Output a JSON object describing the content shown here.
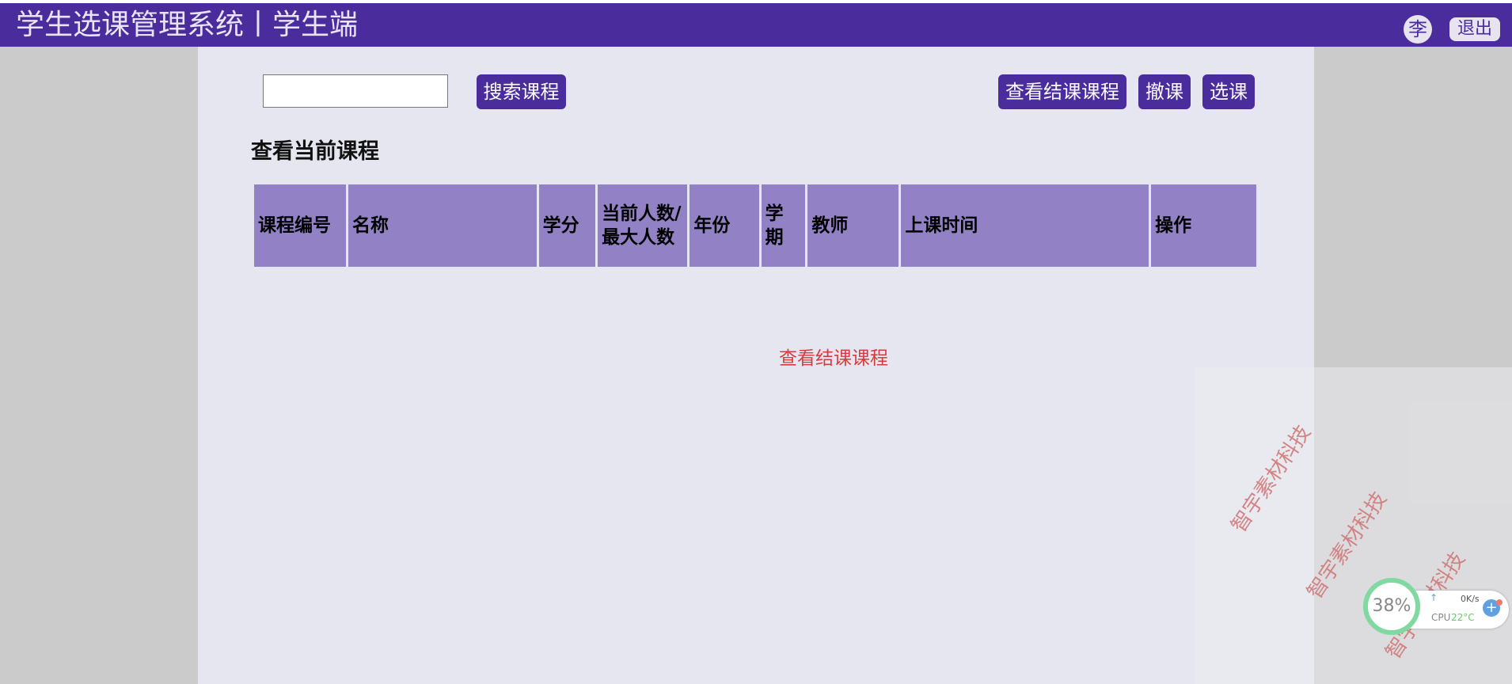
{
  "header": {
    "title": "学生选课管理系统丨学生端",
    "avatar_text": "李",
    "logout_label": "退出"
  },
  "toolbar": {
    "search_value": "",
    "search_label": "搜索课程",
    "view_finished_label": "查看结课课程",
    "drop_label": "撤课",
    "select_label": "选课"
  },
  "section": {
    "title": "查看当前课程"
  },
  "table": {
    "headers": [
      "课程编号",
      "名称",
      "学分",
      "当前人数/最大人数",
      "年份",
      "学期",
      "教师",
      "上课时间",
      "操作"
    ],
    "rows": []
  },
  "link_finished": "查看结课课程",
  "watermark": {
    "text": "智宇素材科技"
  },
  "system_widget": {
    "cpu_percent": "38%",
    "net_speed": "0K/s",
    "cpu_label": "CPU",
    "temperature": "22°C"
  },
  "colors": {
    "header_bg": "#4a2c9c",
    "button_bg": "#4a2c9c",
    "table_header_bg": "#9381c6",
    "main_bg": "#e6e6f0",
    "link_red": "#d33d3d"
  }
}
